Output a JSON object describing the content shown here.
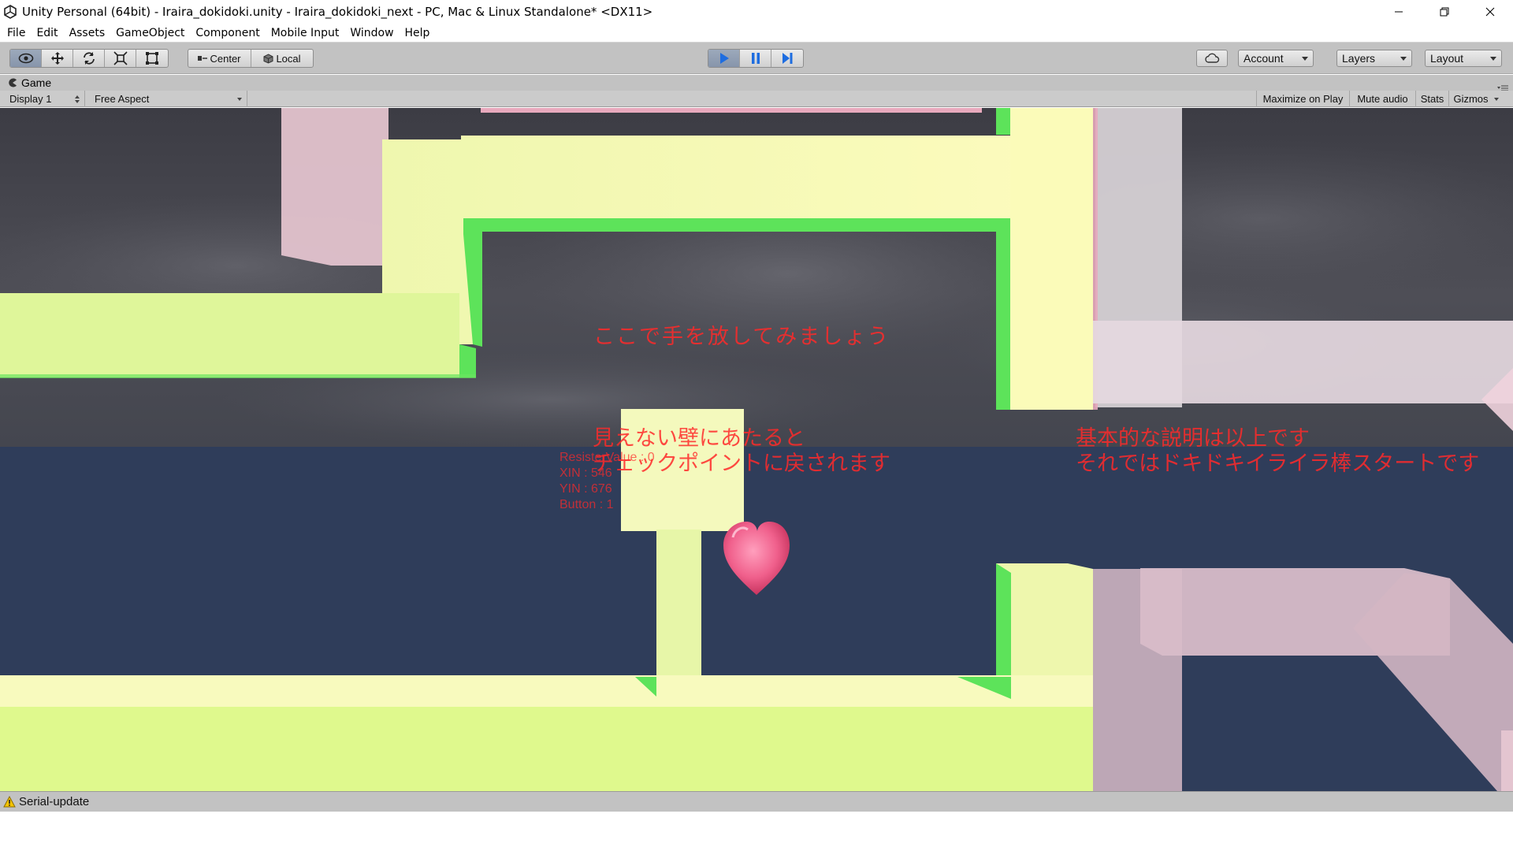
{
  "window": {
    "title": "Unity Personal (64bit) - Iraira_dokidoki.unity - Iraira_dokidoki_next - PC, Mac & Linux Standalone* <DX11>"
  },
  "menu": [
    "File",
    "Edit",
    "Assets",
    "GameObject",
    "Component",
    "Mobile Input",
    "Window",
    "Help"
  ],
  "toolbar": {
    "pivot_label": "Center",
    "space_label": "Local",
    "account_label": "Account",
    "layers_label": "Layers",
    "layout_label": "Layout",
    "play_active": true
  },
  "game_panel": {
    "tab_label": "Game",
    "display_label": "Display 1",
    "aspect_label": "Free Aspect",
    "maximize_label": "Maximize on Play",
    "mute_label": "Mute audio",
    "stats_label": "Stats",
    "gizmos_label": "Gizmos"
  },
  "game_text": {
    "hint_release": "ここで手を放してみましょう",
    "hint_wall_line1": "見えない壁にあたると",
    "hint_wall_line2": "チェックポイントに戻されます",
    "end_line1": "基本的な説明は以上です",
    "end_line2": "それではドキドキイライラ棒スタートです"
  },
  "debug": {
    "resister": "ResisterValue : 0",
    "xin": "XIN : 546",
    "yin": "YIN : 676",
    "button": "Button : 1"
  },
  "colors": {
    "sky_cloud": "#4a4a52",
    "sky_lower": "#2f3d5a",
    "wall_light": "#eef7a8",
    "wall_green": "#5de35a",
    "wall_pink": "#e3c3ce",
    "text_red": "#ff2a2a",
    "heart": "#f0608c"
  },
  "status": {
    "message": "Serial-update"
  }
}
